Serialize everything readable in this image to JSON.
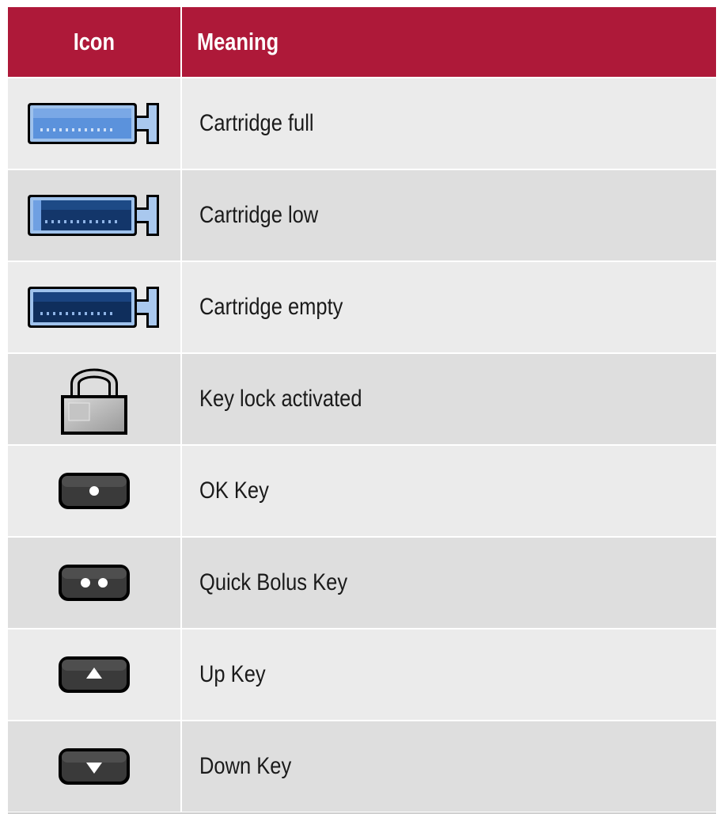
{
  "table": {
    "header": {
      "icon": "Icon",
      "meaning": "Meaning"
    },
    "rows": [
      {
        "icon": "cartridge-full-icon",
        "meaning": "Cartridge full"
      },
      {
        "icon": "cartridge-low-icon",
        "meaning": "Cartridge low"
      },
      {
        "icon": "cartridge-empty-icon",
        "meaning": "Cartridge empty"
      },
      {
        "icon": "key-lock-icon",
        "meaning": "Key lock activated"
      },
      {
        "icon": "ok-key-icon",
        "meaning": "OK Key"
      },
      {
        "icon": "quick-bolus-key-icon",
        "meaning": "Quick Bolus Key"
      },
      {
        "icon": "up-key-icon",
        "meaning": "Up Key"
      },
      {
        "icon": "down-key-icon",
        "meaning": "Down Key"
      }
    ]
  },
  "colors": {
    "header_bg": "#ae1939",
    "row_light": "#ebebeb",
    "row_dark": "#dedede",
    "cartridge_blue": "#4f86d6",
    "cartridge_dark": "#0f2e5c",
    "key_dark": "#262626"
  }
}
